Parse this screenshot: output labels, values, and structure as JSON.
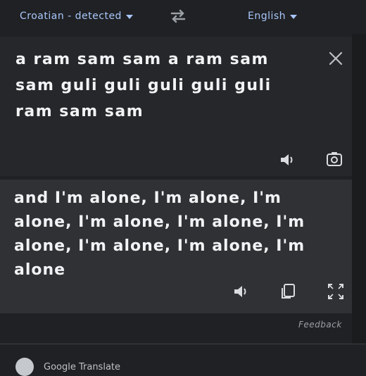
{
  "lang_bar": {
    "source_lang": "Croatian - detected",
    "target_lang": "English",
    "swap_icon": "swap-arrows-icon"
  },
  "source": {
    "text": "a ram sam sam a ram sam sam guli guli guli guli guli ram sam sam",
    "close_icon": "close-icon",
    "listen_icon": "speaker-icon",
    "camera_icon": "camera-translate-icon"
  },
  "target": {
    "text": "and I'm alone, I'm alone, I'm alone, I'm alone, I'm alone, I'm alone, I'm alone, I'm alone, I'm alone",
    "listen_icon": "speaker-icon",
    "copy_icon": "copy-icon",
    "expand_icon": "expand-icon"
  },
  "feedback": "Feedback",
  "footer": {
    "text": "Google Translate"
  },
  "colors": {
    "accent": "#a8c7fa",
    "background": "#202124",
    "target_panel": "#303134"
  }
}
